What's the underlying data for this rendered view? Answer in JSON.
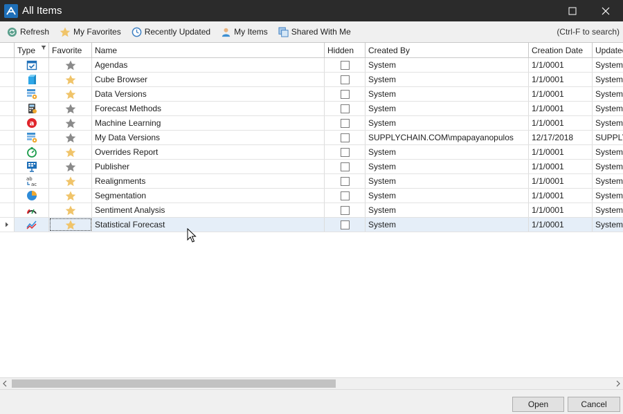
{
  "window": {
    "title": "All Items"
  },
  "toolbar": {
    "refresh": "Refresh",
    "favorites": "My Favorites",
    "recent": "Recently Updated",
    "my_items": "My Items",
    "shared": "Shared With Me",
    "search_hint": "(Ctrl-F to search)"
  },
  "columns": {
    "type": "Type",
    "favorite": "Favorite",
    "name": "Name",
    "hidden": "Hidden",
    "created_by": "Created By",
    "creation_date": "Creation Date",
    "updated_by": "Updated By"
  },
  "rows": [
    {
      "name": "Agendas",
      "created_by": "System",
      "creation_date": "1/1/0001",
      "updated_by": "System",
      "favorite": false,
      "icon": "agenda-icon"
    },
    {
      "name": "Cube Browser",
      "created_by": "System",
      "creation_date": "1/1/0001",
      "updated_by": "System",
      "favorite": true,
      "icon": "cube-icon"
    },
    {
      "name": "Data Versions",
      "created_by": "System",
      "creation_date": "1/1/0001",
      "updated_by": "System",
      "favorite": true,
      "icon": "data-versions-icon"
    },
    {
      "name": "Forecast Methods",
      "created_by": "System",
      "creation_date": "1/1/0001",
      "updated_by": "System",
      "favorite": false,
      "icon": "calculator-icon"
    },
    {
      "name": "Machine Learning",
      "created_by": "System",
      "creation_date": "1/1/0001",
      "updated_by": "System",
      "favorite": false,
      "icon": "machine-learning-icon"
    },
    {
      "name": "My Data Versions",
      "created_by": "SUPPLYCHAIN.COM\\mpapayanopulos",
      "creation_date": "12/17/2018",
      "updated_by": "SUPPLYCHAIN.COM\\mpapayanopulos",
      "favorite": false,
      "icon": "data-versions-icon"
    },
    {
      "name": "Overrides Report",
      "created_by": "System",
      "creation_date": "1/1/0001",
      "updated_by": "System",
      "favorite": true,
      "icon": "overrides-icon"
    },
    {
      "name": "Publisher",
      "created_by": "System",
      "creation_date": "1/1/0001",
      "updated_by": "System",
      "favorite": false,
      "icon": "publisher-icon"
    },
    {
      "name": "Realignments",
      "created_by": "System",
      "creation_date": "1/1/0001",
      "updated_by": "System",
      "favorite": true,
      "icon": "realignment-icon"
    },
    {
      "name": "Segmentation",
      "created_by": "System",
      "creation_date": "1/1/0001",
      "updated_by": "System",
      "favorite": true,
      "icon": "pie-chart-icon"
    },
    {
      "name": "Sentiment Analysis",
      "created_by": "System",
      "creation_date": "1/1/0001",
      "updated_by": "System",
      "favorite": true,
      "icon": "gauge-icon"
    },
    {
      "name": "Statistical Forecast",
      "created_by": "System",
      "creation_date": "1/1/0001",
      "updated_by": "System",
      "favorite": true,
      "icon": "line-chart-icon",
      "selected": true
    }
  ],
  "buttons": {
    "open": "Open",
    "cancel": "Cancel"
  },
  "colors": {
    "titlebar": "#2b2b2b",
    "star_favorite": "#f0c46a",
    "star_default": "#8a8a8a",
    "selected_row": "#e5eef8",
    "accent": "#1e6fb8"
  }
}
